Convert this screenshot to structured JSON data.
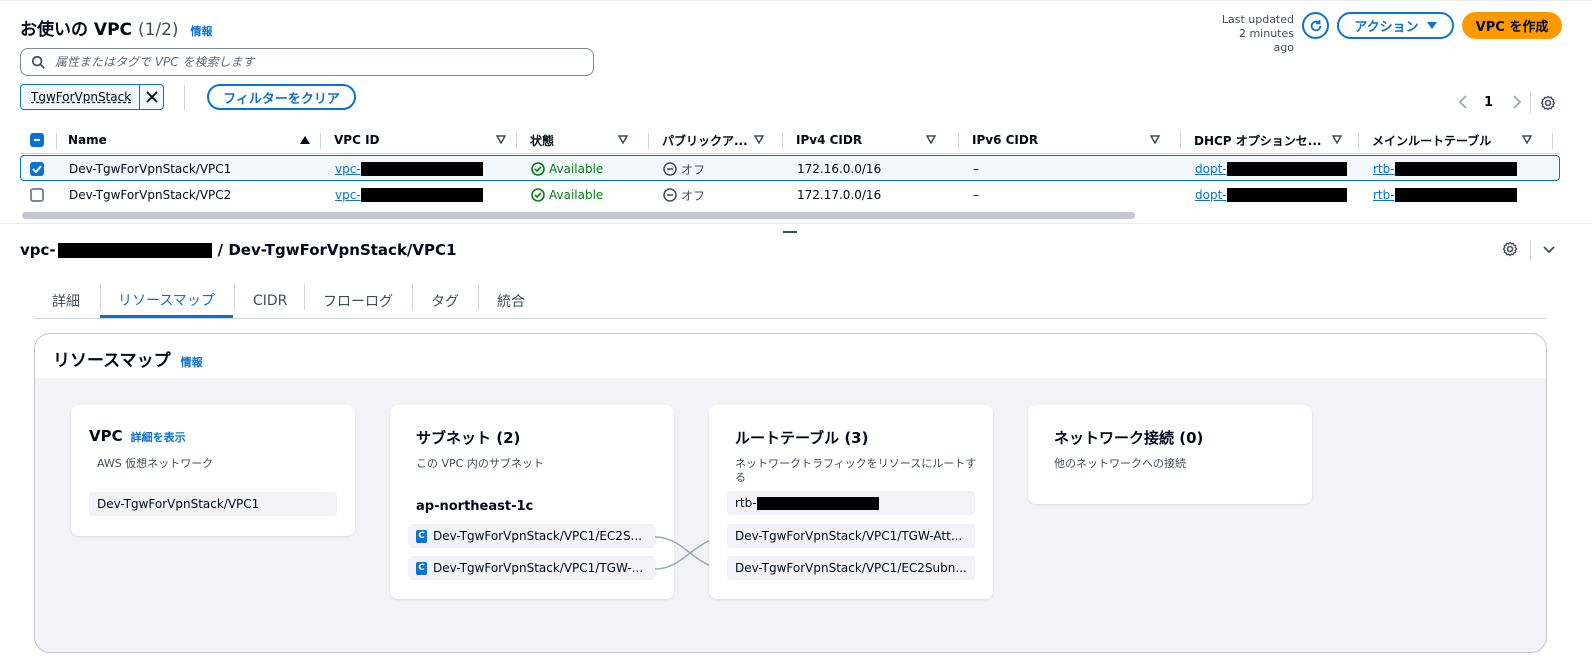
{
  "header": {
    "title": "お使いの VPC",
    "count": "(1/2)",
    "info": "情報",
    "last_updated_line1": "Last updated",
    "last_updated_line2": "2 minutes ago",
    "action_label": "アクション",
    "create_label": "VPC を作成"
  },
  "search": {
    "placeholder": "属性またはタグで VPC を検索します"
  },
  "filter": {
    "token": "TgwForVpnStack",
    "clear_label": "フィルターをクリア"
  },
  "pagination": {
    "current": "1"
  },
  "table": {
    "columns": [
      "Name",
      "VPC ID",
      "状態",
      "パブリックア...",
      "IPv4 CIDR",
      "IPv6 CIDR",
      "DHCP オプションセ...",
      "メインルートテーブル"
    ],
    "rows": [
      {
        "selected": true,
        "name": "Dev-TgwForVpnStack/VPC1",
        "vpc_id_prefix": "vpc-",
        "status": "Available",
        "public": "オフ",
        "ipv4": "172.16.0.0/16",
        "ipv6": "–",
        "dhcp_prefix": "dopt-",
        "rtb_prefix": "rtb-"
      },
      {
        "selected": false,
        "name": "Dev-TgwForVpnStack/VPC2",
        "vpc_id_prefix": "vpc-",
        "status": "Available",
        "public": "オフ",
        "ipv4": "172.17.0.0/16",
        "ipv6": "–",
        "dhcp_prefix": "dopt-",
        "rtb_prefix": "rtb-"
      }
    ]
  },
  "detail": {
    "title_prefix": "vpc-",
    "title_suffix": "/ Dev-TgwForVpnStack/VPC1",
    "tabs": [
      "詳細",
      "リソースマップ",
      "CIDR",
      "フローログ",
      "タグ",
      "統合"
    ],
    "active_tab": 1
  },
  "resource_map": {
    "title": "リソースマップ",
    "info": "情報",
    "vpc": {
      "title": "VPC",
      "link": "詳細を表示",
      "desc": "AWS 仮想ネットワーク",
      "value": "Dev-TgwForVpnStack/VPC1"
    },
    "subnets": {
      "title": "サブネット (2)",
      "desc": "この VPC 内のサブネット",
      "az": "ap-northeast-1c",
      "badge": "C",
      "items": [
        "Dev-TgwForVpnStack/VPC1/EC2S...",
        "Dev-TgwForVpnStack/VPC1/TGW-..."
      ]
    },
    "route_tables": {
      "title": "ルートテーブル (3)",
      "desc": "ネットワークトラフィックをリソースにルートする",
      "first_prefix": "rtb-",
      "items": [
        "Dev-TgwForVpnStack/VPC1/TGW-Att...",
        "Dev-TgwForVpnStack/VPC1/EC2Subn..."
      ]
    },
    "network": {
      "title": "ネットワーク接続 (0)",
      "desc": "他のネットワークへの接続"
    }
  },
  "colors": {
    "accent": "#0972d3",
    "primary_button": "#ff9900",
    "success": "#037f0c"
  }
}
